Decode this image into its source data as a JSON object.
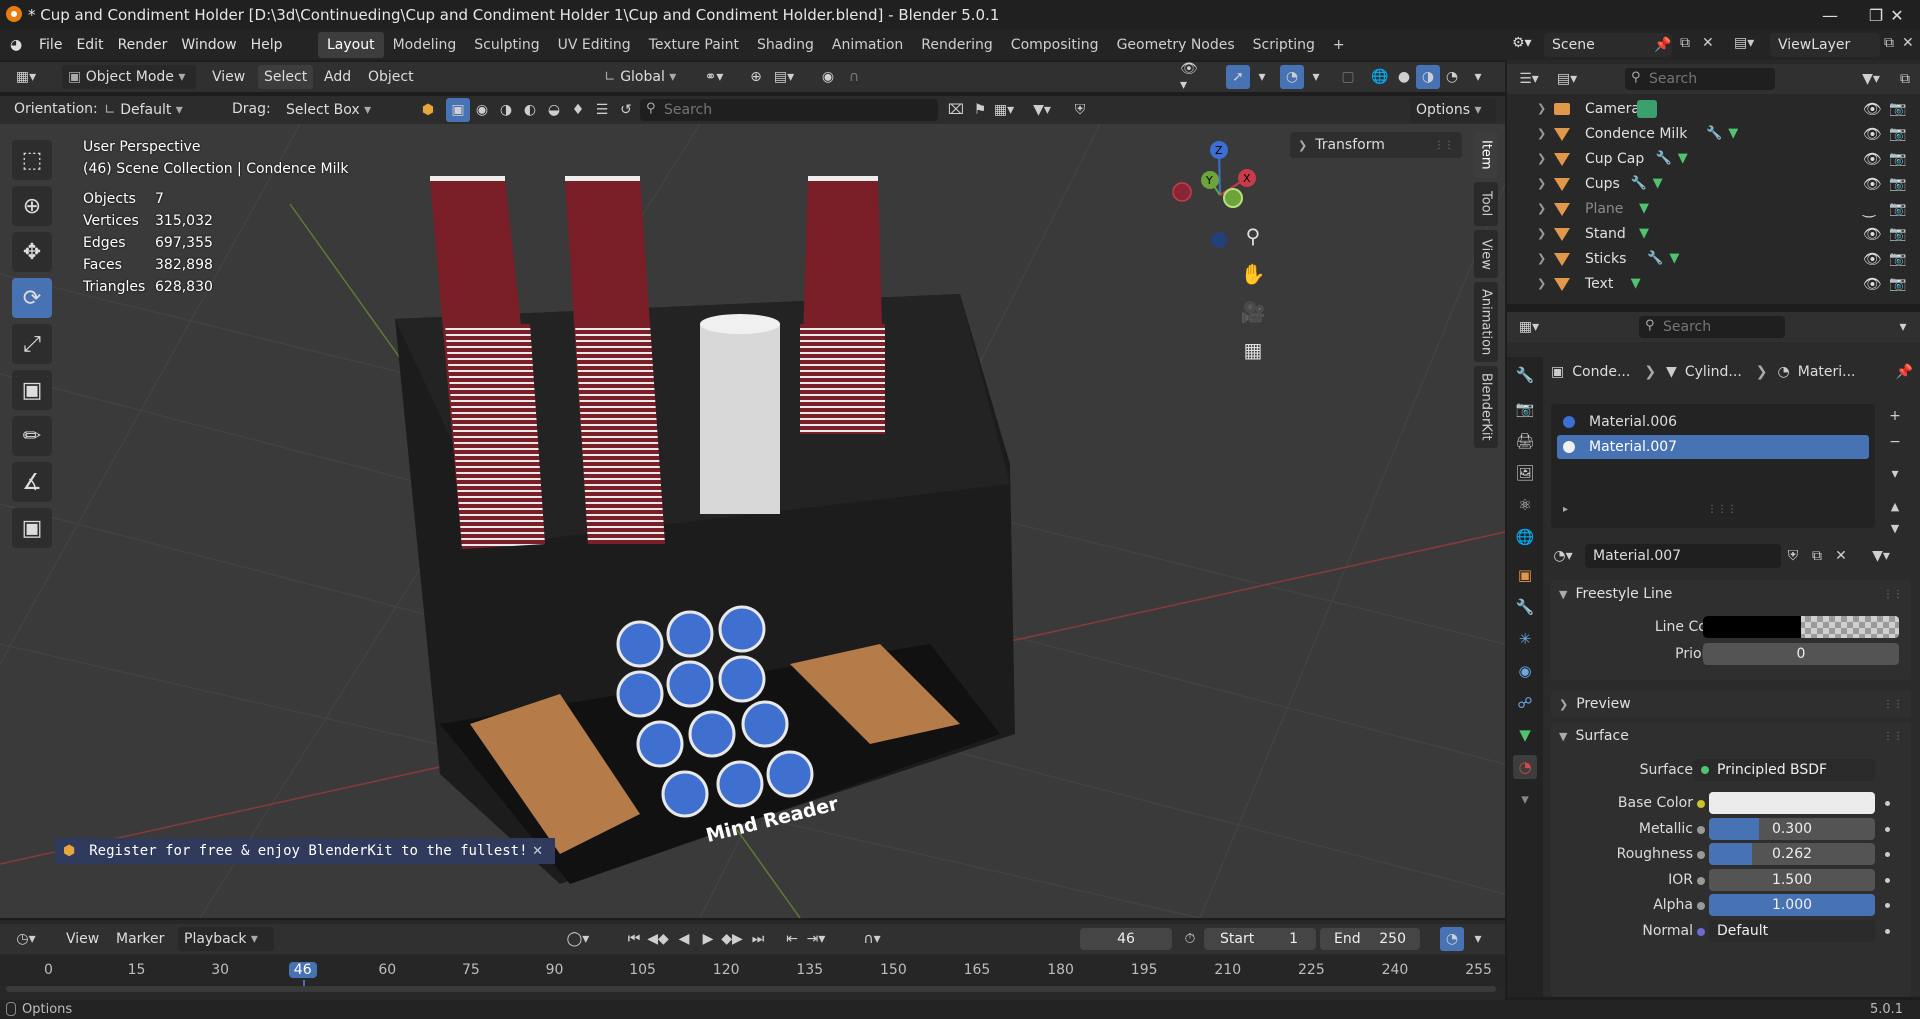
{
  "titlebar": {
    "title": "* Cup and Condiment Holder [D:\\3d\\Continueding\\Cup and Condiment Holder 1\\Cup and Condiment Holder.blend] - Blender 5.0.1"
  },
  "menubar": {
    "menus": [
      "File",
      "Edit",
      "Render",
      "Window",
      "Help"
    ],
    "workspaces": [
      "Layout",
      "Modeling",
      "Sculpting",
      "UV Editing",
      "Texture Paint",
      "Shading",
      "Animation",
      "Rendering",
      "Compositing",
      "Geometry Nodes",
      "Scripting"
    ],
    "active_workspace": "Layout",
    "scene": "Scene",
    "view_layer": "ViewLayer"
  },
  "viewport_header": {
    "mode": "Object Mode",
    "menus": [
      "View",
      "Select",
      "Add",
      "Object"
    ],
    "transform_orientation": "Global",
    "orientation_label": "Orientation:",
    "orientation_value": "Default",
    "drag_label": "Drag:",
    "drag_value": "Select Box",
    "search_placeholder": "Search",
    "options_label": "Options"
  },
  "viewport": {
    "perspective": "User Perspective",
    "collection": "(46) Scene Collection | Condence Milk",
    "stats": [
      {
        "label": "Objects",
        "value": "7"
      },
      {
        "label": "Vertices",
        "value": "315,032"
      },
      {
        "label": "Edges",
        "value": "697,355"
      },
      {
        "label": "Faces",
        "value": "382,898"
      },
      {
        "label": "Triangles",
        "value": "628,830"
      }
    ],
    "transform_panel": "Transform",
    "side_tabs": [
      "Item",
      "Tool",
      "View",
      "Animation",
      "BlenderKit"
    ],
    "gizmo_axes": [
      "Z",
      "Y",
      "X"
    ],
    "model_text": "Mind Reader",
    "notification": "Register for free & enjoy BlenderKit to the fullest!"
  },
  "outliner": {
    "search_placeholder": "Search",
    "items": [
      {
        "name": "Camera",
        "icon": "camera-icon",
        "modifiers": [],
        "visible": true
      },
      {
        "name": "Condence Milk",
        "icon": "mesh-object-icon",
        "modifiers": [
          "wrench-icon",
          "mesh-data-icon"
        ],
        "visible": true
      },
      {
        "name": "Cup Cap",
        "icon": "mesh-object-icon",
        "modifiers": [
          "wrench-icon",
          "mesh-data-icon"
        ],
        "visible": true
      },
      {
        "name": "Cups",
        "icon": "mesh-object-icon",
        "modifiers": [
          "wrench-icon",
          "mesh-data-icon"
        ],
        "visible": true
      },
      {
        "name": "Plane",
        "icon": "mesh-object-icon",
        "modifiers": [
          "mesh-data-icon"
        ],
        "visible": false
      },
      {
        "name": "Stand",
        "icon": "mesh-object-icon",
        "modifiers": [
          "mesh-data-icon"
        ],
        "visible": true
      },
      {
        "name": "Sticks",
        "icon": "mesh-object-icon",
        "modifiers": [
          "wrench-icon",
          "mesh-data-icon"
        ],
        "visible": true
      },
      {
        "name": "Text",
        "icon": "mesh-object-icon",
        "modifiers": [
          "mesh-data-icon"
        ],
        "visible": true
      }
    ]
  },
  "properties": {
    "search_placeholder": "Search",
    "breadcrumb": [
      "Conde...",
      "Cylind...",
      "Materi..."
    ],
    "material_slots": [
      "Material.006",
      "Material.007"
    ],
    "active_slot": "Material.007",
    "material_name": "Material.007",
    "sections": {
      "freestyle": "Freestyle Line",
      "preview": "Preview",
      "surface": "Surface"
    },
    "freestyle": {
      "line_color_label": "Line Color",
      "priority_label": "Priority",
      "priority_value": "0"
    },
    "surface": {
      "surface_label": "Surface",
      "surface_value": "Principled BSDF",
      "fields": [
        {
          "label": "Base Color",
          "value": "",
          "fill": 0,
          "dot": "#c9c42a"
        },
        {
          "label": "Metallic",
          "value": "0.300",
          "fill": 0.3,
          "dot": "#999999"
        },
        {
          "label": "Roughness",
          "value": "0.262",
          "fill": 0.262,
          "dot": "#999999"
        },
        {
          "label": "IOR",
          "value": "1.500",
          "fill": 0,
          "dot": "#999999"
        },
        {
          "label": "Alpha",
          "value": "1.000",
          "fill": 1.0,
          "dot": "#999999"
        },
        {
          "label": "Normal",
          "value": "Default",
          "fill": 0,
          "dot": "#6b6bd6"
        }
      ]
    }
  },
  "timeline": {
    "menus": [
      "View",
      "Marker",
      "Playback"
    ],
    "current_frame": "46",
    "start_label": "Start",
    "start_value": "1",
    "end_label": "End",
    "end_value": "250",
    "ruler": [
      "0",
      "15",
      "30",
      "46",
      "60",
      "75",
      "90",
      "105",
      "120",
      "135",
      "150",
      "165",
      "180",
      "195",
      "210",
      "225",
      "240",
      "255"
    ]
  },
  "statusbar": {
    "left": "Options",
    "version": "5.0.1"
  },
  "colors": {
    "accent": "#4772b3",
    "selected_slot": "#4772b3",
    "outliner_orange": "#e2984a",
    "mesh_green": "#4fc36f",
    "wrench_blue": "#6aa7e6"
  }
}
